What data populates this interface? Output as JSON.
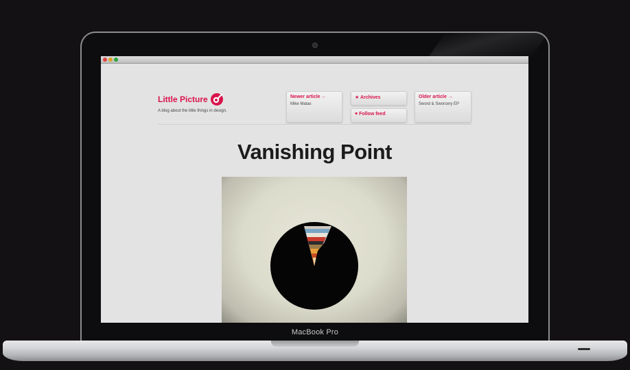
{
  "device": {
    "label": "MacBook Pro"
  },
  "blog": {
    "name": "Little Picture",
    "tagline": "A blog about the little things in design.",
    "accent_color": "#d9134b"
  },
  "nav": {
    "newer": {
      "title": "Newer article ←",
      "subtitle": "Mike Matas"
    },
    "archives": {
      "title": "★ Archives"
    },
    "follow": {
      "title": "♥ Follow feed"
    },
    "older": {
      "title": "Older article →",
      "subtitle": "Sword & Sworcery EP"
    }
  },
  "article": {
    "title": "Vanishing Point"
  },
  "icons": {
    "logo": "camera-eye-icon",
    "window_controls": [
      "close-icon",
      "minimize-icon",
      "zoom-icon"
    ]
  }
}
